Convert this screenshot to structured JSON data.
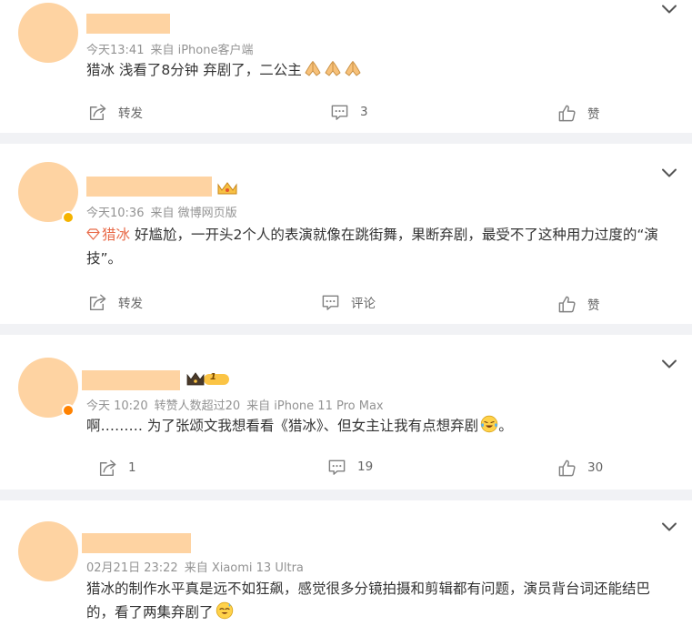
{
  "comments": [
    {
      "meta_time": "今天13:41",
      "meta_source": "来自 iPhone客户端",
      "text": "猎冰 浅看了8分钟 弃剧了，二公主",
      "emoji": [
        "pray-emoji",
        "pray-emoji",
        "pray-emoji"
      ],
      "repost_label": "转发",
      "comment_count": "3",
      "like_label": "赞"
    },
    {
      "meta_time": "今天10:36",
      "meta_source": "来自 微博网页版",
      "topic": "猎冰",
      "text": "好尴尬，一开头2个人的表演就像在跳街舞，果断弃剧，最受不了这种用力过度的“演技”。",
      "repost_label": "转发",
      "comment_label": "评论",
      "like_label": "赞"
    },
    {
      "meta_time": "今天 10:20",
      "meta_reposts": "转赞人数超过20",
      "meta_source": "来自 iPhone 11 Pro Max",
      "badge_level": "1",
      "text": "啊……… 为了张颂文我想看看《猎冰》、但女主让我有点想弃剧",
      "text_tail": "。",
      "emoji": [
        "crying-laughing-emoji"
      ],
      "repost_count": "1",
      "comment_count": "19",
      "like_count": "30"
    },
    {
      "meta_time": "02月21日 23:22",
      "meta_source": "来自 Xiaomi 13 Ultra",
      "text": "猎冰的制作水平真是远不如狂飙，感觉很多分镜拍摄和剪辑都有问题，演员背台词还能结巴的，看了两集弃剧了",
      "emoji": [
        "sweat-smile-emoji"
      ]
    }
  ],
  "colors": {
    "avatar_placeholder": "#fed3a2",
    "background": "#f1f2f5",
    "topic_link": "#e86a48",
    "verified_yellow": "#f5b300",
    "verified_orange": "#ff8200"
  }
}
